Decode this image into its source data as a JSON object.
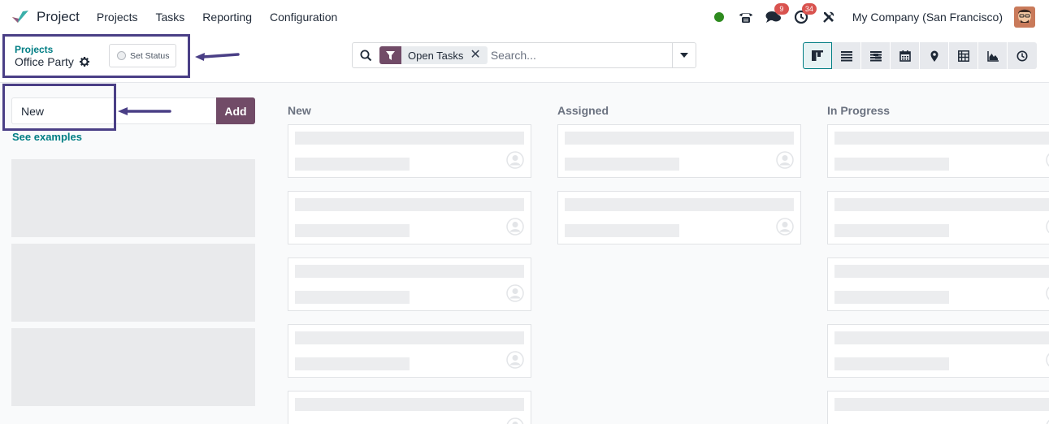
{
  "navbar": {
    "app_name": "Project",
    "menu": [
      "Projects",
      "Tasks",
      "Reporting",
      "Configuration"
    ],
    "messages_badge": "9",
    "activities_badge": "34",
    "company": "My Company (San Francisco)",
    "icons": [
      "phone-icon",
      "chat-icon",
      "clock-icon",
      "tools-icon"
    ],
    "presence_color": "#2e8b1f"
  },
  "control_panel": {
    "breadcrumb_root": "Projects",
    "breadcrumb_current": "Office Party",
    "status_label": "Set Status",
    "search": {
      "facet_label": "Open Tasks",
      "placeholder": "Search..."
    },
    "views": [
      "kanban",
      "list",
      "gantt",
      "calendar",
      "map",
      "pivot",
      "graph",
      "activity"
    ],
    "active_view": "kanban"
  },
  "kanban": {
    "quick_create": {
      "value": "New",
      "add_label": "Add",
      "examples_label": "See examples"
    },
    "columns": [
      {
        "title": "New",
        "cards": 5
      },
      {
        "title": "Assigned",
        "cards": 2
      },
      {
        "title": "In Progress",
        "cards": 5
      }
    ]
  },
  "colors": {
    "accent": "#714b67",
    "link": "#017e84",
    "annotation": "#4a3f86"
  }
}
